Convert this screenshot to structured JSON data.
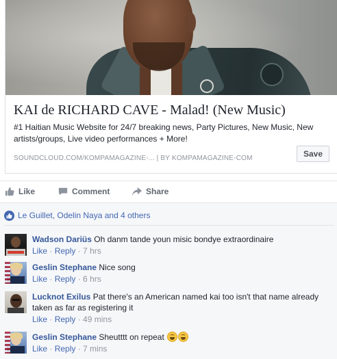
{
  "link_preview": {
    "title": "KAI de RICHARD CAVE - Malad! (New Music)",
    "description": "#1 Haitian Music Website for 24/7 breaking news, Party Pictures, New Music, New artists/groups, Live video performances + More!",
    "source": "SOUNDCLOUD.COM/KOMPAMAGAZINE-... | BY KOMPAMAGAZINE-COM",
    "save_label": "Save"
  },
  "actions": {
    "like": "Like",
    "comment": "Comment",
    "share": "Share"
  },
  "reactions": {
    "text": "Le Guillet, Odelin Naya and 4 others",
    "icon": "like-icon"
  },
  "comments": [
    {
      "author": "Wadson Dariüs",
      "text": "Oh danm tande youn misic bondye extraordinaire",
      "like": "Like",
      "reply": "Reply",
      "time": "7 hrs"
    },
    {
      "author": "Geslin Stephane",
      "text": "Nice song",
      "like": "Like",
      "reply": "Reply",
      "time": "6 hrs"
    },
    {
      "author": "Lucknot Exilus",
      "text": "Pat there's an American named kai too isn't that name already taken as far as registering it",
      "like": "Like",
      "reply": "Reply",
      "time": "49 mins"
    },
    {
      "author": "Geslin Stephane",
      "text": "Sheutttt on repeat",
      "like": "Like",
      "reply": "Reply",
      "time": "7 mins"
    }
  ],
  "colors": {
    "link": "#365899",
    "accent": "#4267b2",
    "muted": "#90949c"
  }
}
